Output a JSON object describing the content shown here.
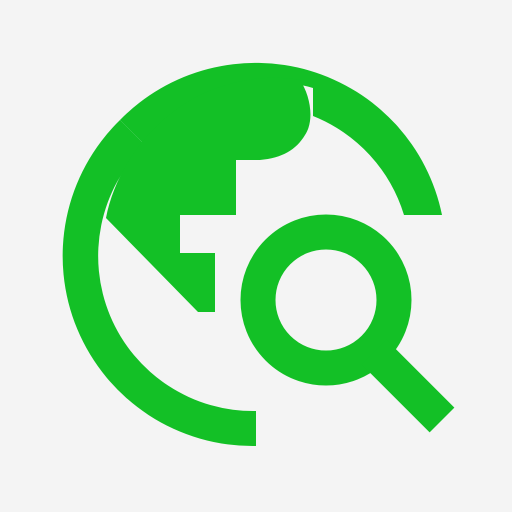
{
  "icon": {
    "name": "travel-explore-icon",
    "description_parts": [
      "globe-icon",
      "magnifier-icon"
    ],
    "colors": {
      "background": "#f4f4f4",
      "foreground": "#13c026"
    }
  }
}
